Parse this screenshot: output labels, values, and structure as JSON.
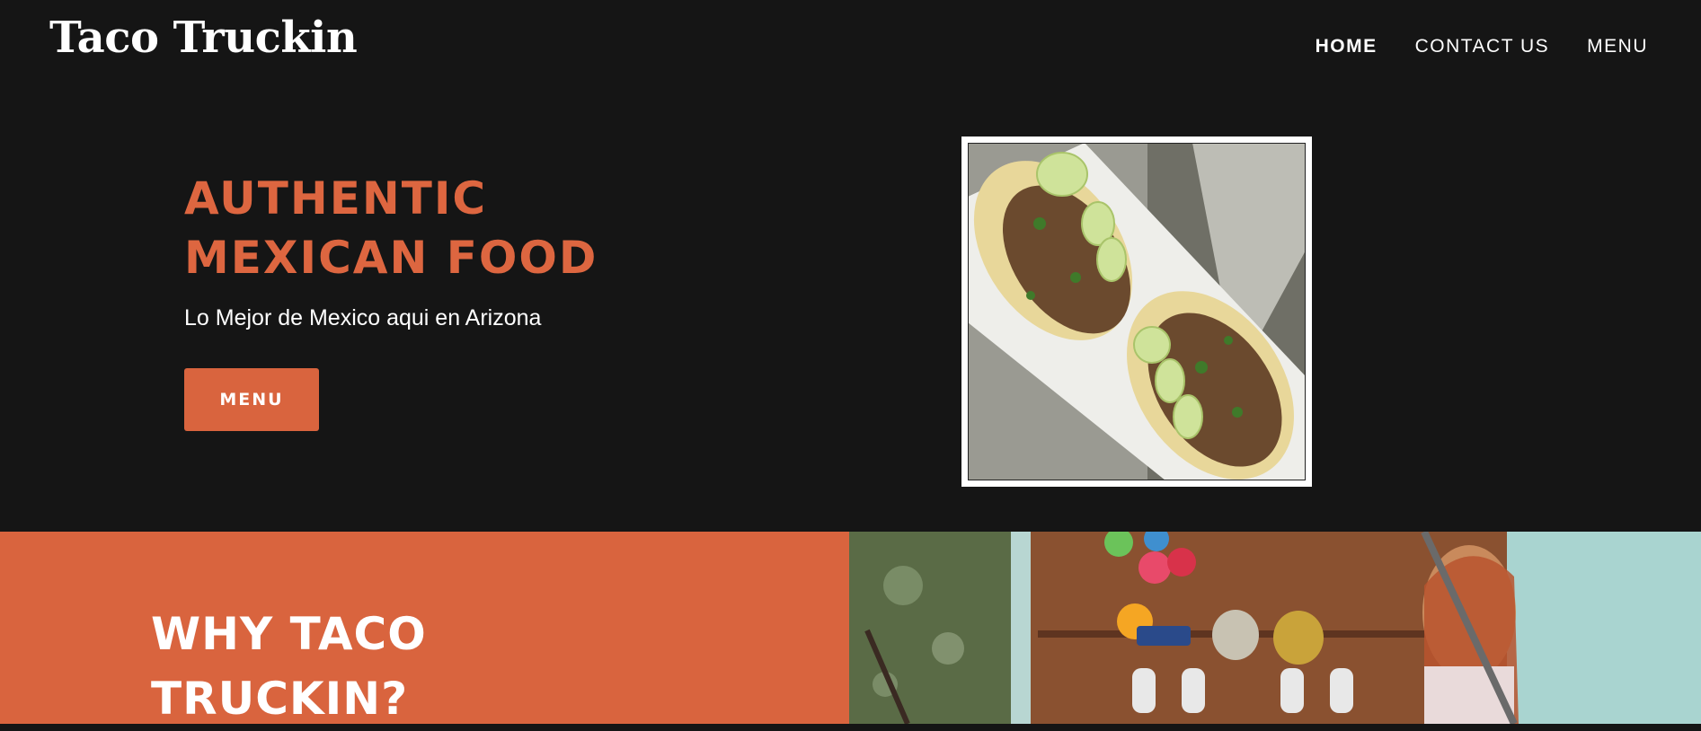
{
  "header": {
    "logo": "Taco Truckin",
    "nav": [
      {
        "label": "HOME",
        "active": true
      },
      {
        "label": "CONTACT US",
        "active": false
      },
      {
        "label": "MENU",
        "active": false
      }
    ]
  },
  "hero": {
    "title_line1": "AUTHENTIC",
    "title_line2": "MEXICAN FOOD",
    "subtitle": "Lo Mejor de Mexico aqui en Arizona",
    "button_label": "MENU"
  },
  "why": {
    "title_line1": "WHY TACO",
    "title_line2": "TRUCKIN?"
  },
  "colors": {
    "background": "#151515",
    "accent": "#d9643e",
    "text": "#ffffff"
  }
}
